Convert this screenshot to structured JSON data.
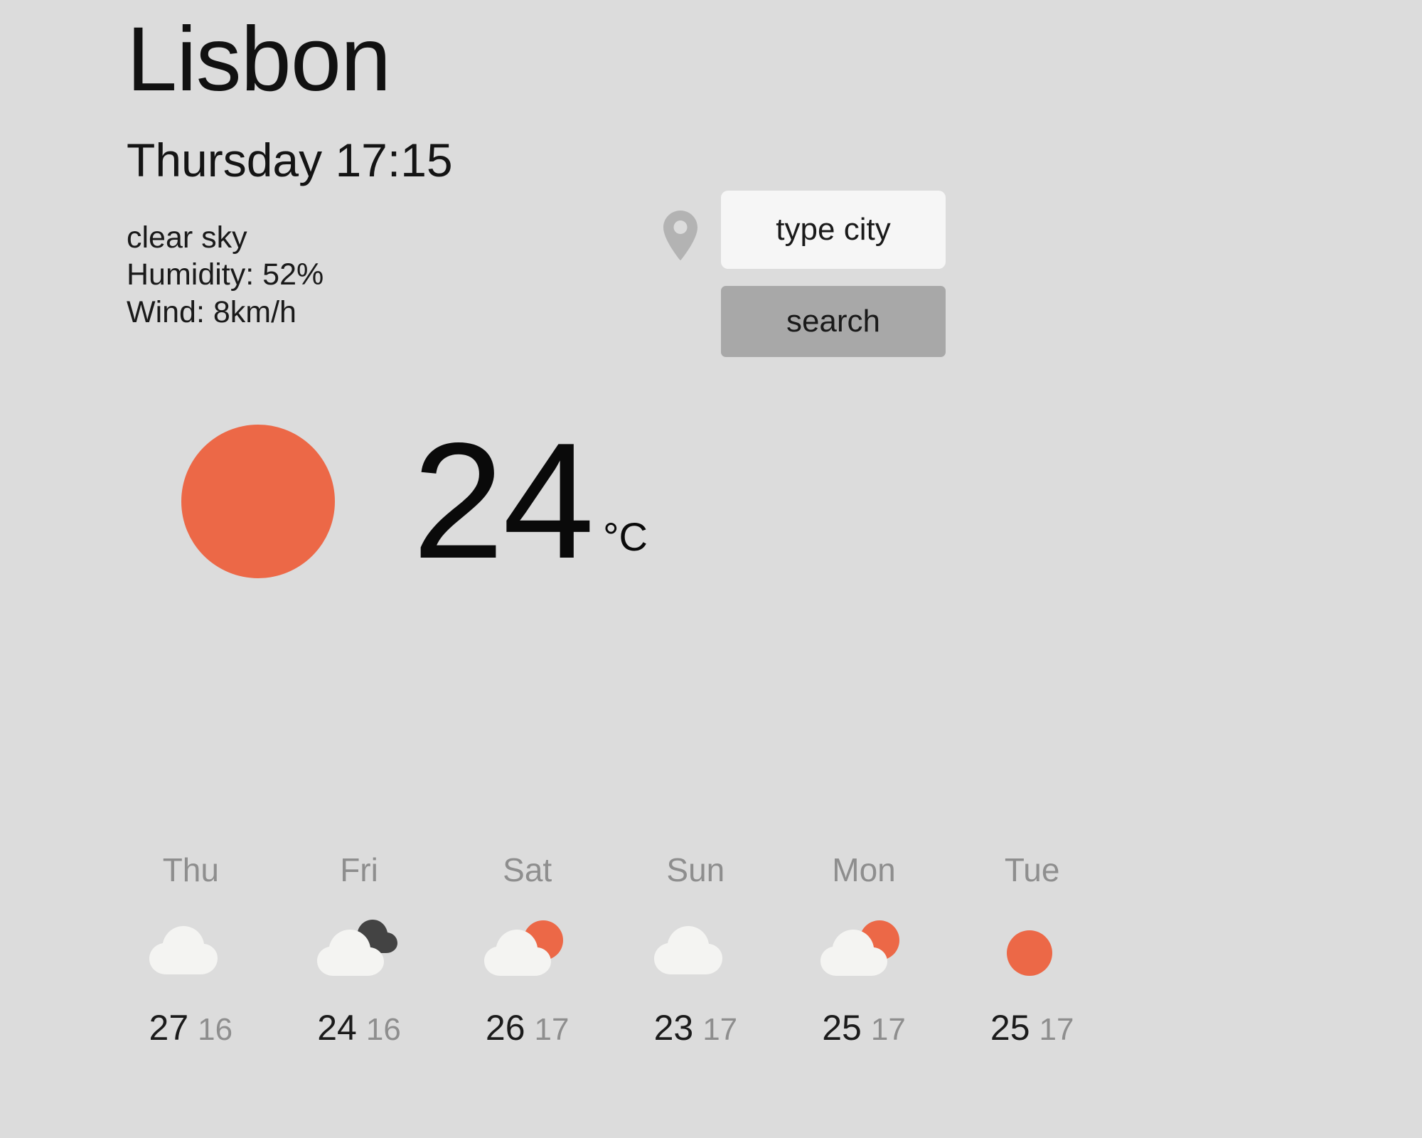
{
  "theme": {
    "background": "#dcdcdc",
    "accent_orange": "#ec6847",
    "cloud_light": "#f4f4f2",
    "cloud_dark": "#434343",
    "muted_text": "#8e8e8e",
    "input_background": "#f6f6f6",
    "button_background": "#a8a8a8"
  },
  "header": {
    "city": "Lisbon",
    "date_time": "Thursday 17:15",
    "details": [
      "clear sky",
      "Humidity: 52%",
      "Wind: 8km/h"
    ]
  },
  "search": {
    "pin_icon": "location-pin-icon",
    "input_value": "",
    "input_placeholder": "type city",
    "button_label": "search"
  },
  "current": {
    "icon": "sun-icon",
    "temperature": "24",
    "unit": "°C"
  },
  "forecast": {
    "days": [
      {
        "label": "Thu",
        "icon": "cloud-icon",
        "high": "27",
        "low": "16"
      },
      {
        "label": "Fri",
        "icon": "clouds-broken-icon",
        "high": "24",
        "low": "16"
      },
      {
        "label": "Sat",
        "icon": "cloud-sun-icon",
        "high": "26",
        "low": "17"
      },
      {
        "label": "Sun",
        "icon": "cloud-icon",
        "high": "23",
        "low": "17"
      },
      {
        "label": "Mon",
        "icon": "cloud-sun-icon",
        "high": "25",
        "low": "17"
      },
      {
        "label": "Tue",
        "icon": "sun-icon",
        "high": "25",
        "low": "17"
      }
    ]
  }
}
